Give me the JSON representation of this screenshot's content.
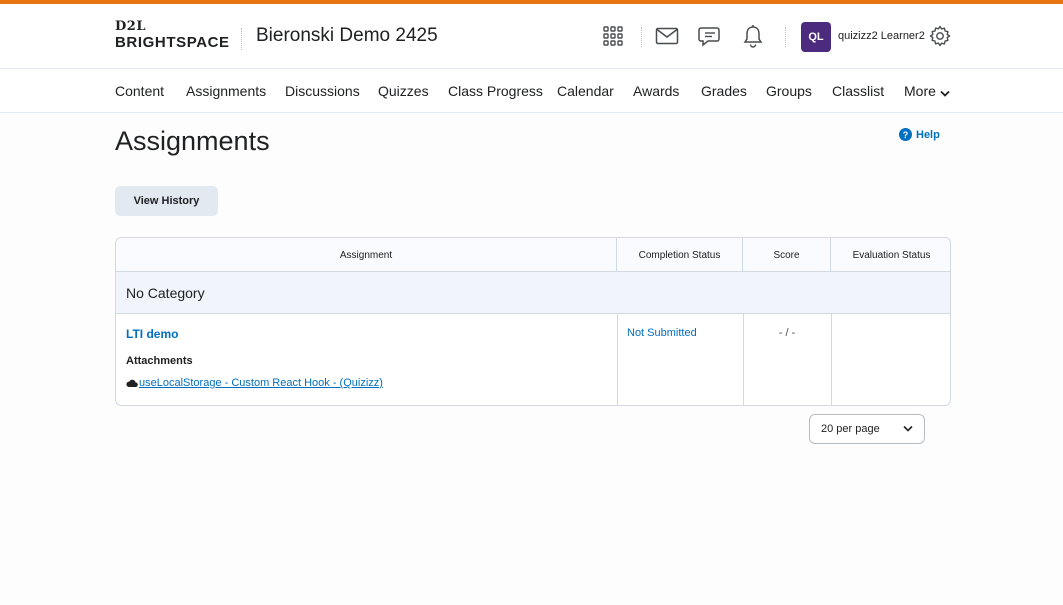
{
  "header": {
    "logo_top": "D2L",
    "logo_bottom": "BRIGHTSPACE",
    "course_title": "Bieronski Demo 2425",
    "icons": [
      "grid-icon",
      "mail-icon",
      "chat-icon",
      "bell-icon",
      "gear-icon"
    ],
    "user_initials": "QL",
    "user_name": "quizizz2 Learner2",
    "accent_color": "#e87511",
    "avatar_color": "#4c2a7d"
  },
  "nav": {
    "items": [
      "Content",
      "Assignments",
      "Discussions",
      "Quizzes",
      "Class Progress",
      "Calendar",
      "Awards",
      "Grades",
      "Groups",
      "Classlist",
      "More"
    ]
  },
  "page": {
    "title": "Assignments",
    "help_label": "Help",
    "help_icon_glyph": "?",
    "view_history_label": "View History"
  },
  "table": {
    "columns": [
      "Assignment",
      "Completion Status",
      "Score",
      "Evaluation Status"
    ],
    "category": "No Category",
    "rows": [
      {
        "name": "LTI demo",
        "attachments_label": "Attachments",
        "attachment": "useLocalStorage - Custom React Hook - (Quizizz)",
        "completion_status": "Not Submitted",
        "score": "- / -",
        "evaluation_status": ""
      }
    ]
  },
  "pagination": {
    "per_page": "20 per page"
  },
  "colors": {
    "link": "#006fbf",
    "border": "#d3d9e3"
  }
}
